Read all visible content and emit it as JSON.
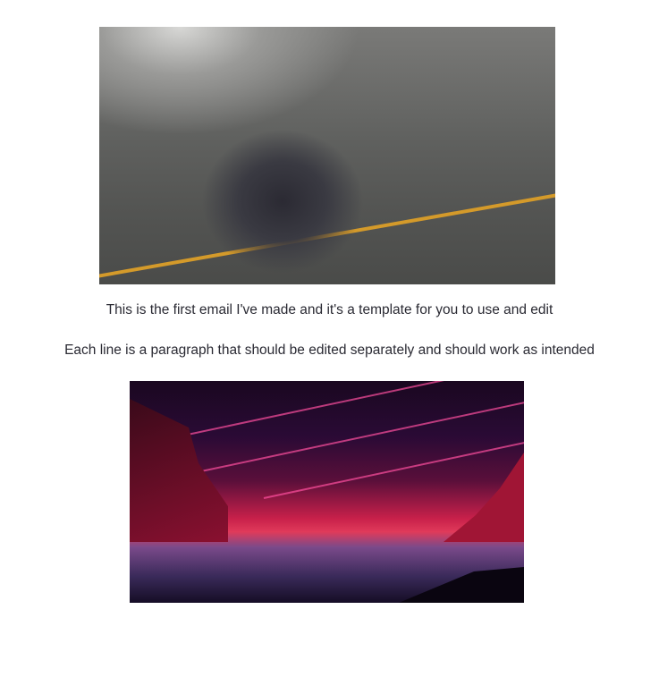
{
  "email": {
    "images": [
      {
        "name": "character-sitting-on-road-image"
      },
      {
        "name": "neon-landscape-with-wolf-image"
      }
    ],
    "paragraphs": [
      "This is the first email I've made and it's a template for you to use and edit",
      "Each line is a paragraph that should be edited separately and should work as intended"
    ]
  }
}
